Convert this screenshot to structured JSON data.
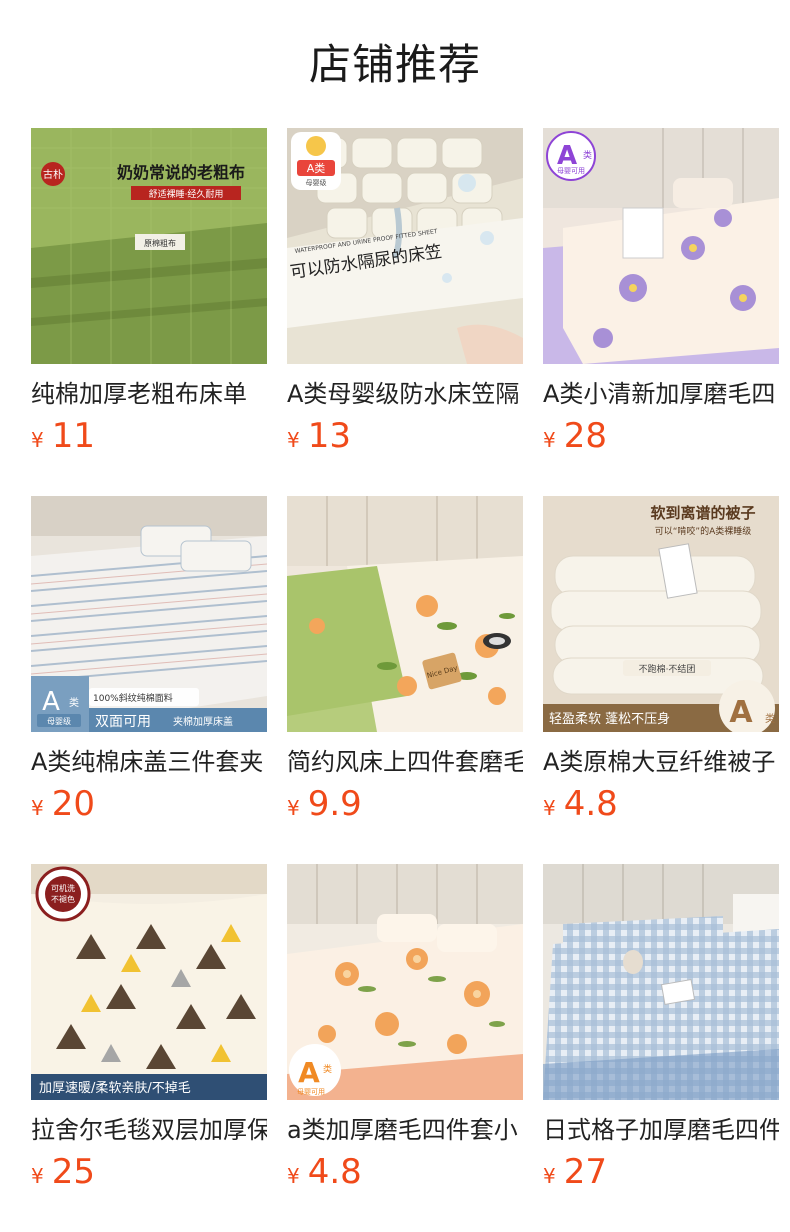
{
  "title": "店铺推荐",
  "currency": "¥",
  "accent_color": "#f04a1a",
  "products": [
    {
      "name": "纯棉加厚老粗布床单",
      "price": "11",
      "image_text": [
        "奶奶常说的老粗布",
        "舒适裸睡·经久耐用",
        "古朴",
        "原棉粗布"
      ]
    },
    {
      "name": "A类母婴级防水床笠隔",
      "price": "13",
      "image_text": [
        "A类",
        "母婴级",
        "WATERPROOF AND URINE PROOF FITTED SHEET",
        "可以防水隔尿的床笠"
      ]
    },
    {
      "name": "A类小清新加厚磨毛四",
      "price": "28",
      "image_text": [
        "A",
        "类",
        "母婴可用"
      ]
    },
    {
      "name": "A类纯棉床盖三件套夹",
      "price": "20",
      "image_text": [
        "A",
        "类",
        "母婴级",
        "100%斜纹纯棉面料",
        "双面可用",
        "夹棉加厚床盖"
      ]
    },
    {
      "name": "简约风床上四件套磨毛",
      "price": "9.9",
      "image_text": [
        "Nice Day"
      ]
    },
    {
      "name": "A类原棉大豆纤维被子",
      "price": "4.8",
      "image_text": [
        "软到离谱的被子",
        "可以“啃咬”的A类裸睡级",
        "不跑棉·不结团",
        "轻盈柔软 蓬松不压身",
        "A",
        "类"
      ]
    },
    {
      "name": "拉舍尔毛毯双层加厚保",
      "price": "25",
      "image_text": [
        "可机洗",
        "不褪色",
        "加厚速暖/柔软亲肤/不掉毛"
      ]
    },
    {
      "name": "a类加厚磨毛四件套小",
      "price": "4.8",
      "image_text": [
        "A",
        "类",
        "母婴可用"
      ]
    },
    {
      "name": "日式格子加厚磨毛四件",
      "price": "27",
      "image_text": []
    }
  ]
}
